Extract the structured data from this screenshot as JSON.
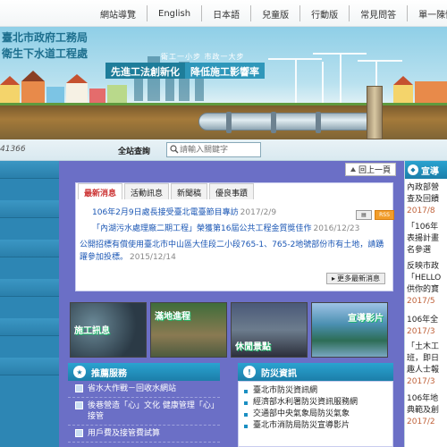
{
  "topnav": {
    "items": [
      "網站導覽",
      "English",
      "日本語",
      "兒童版",
      "行動版",
      "常見問答",
      "單一陳情"
    ]
  },
  "header": {
    "org_line1": "臺北市政府工務局",
    "org_line2": "衛生下水道工程處",
    "slogan_small": "衛工一小步 市政一大步",
    "slogan_a": "先進工法創新化",
    "slogan_b": "降低施工影響率"
  },
  "search": {
    "counter": "41366",
    "label": "全站查詢",
    "placeholder": "請輸入關鍵字"
  },
  "back_top": "回上一頁",
  "news": {
    "tabs": [
      "最新消息",
      "活動訊息",
      "新聞稿",
      "優良事蹟"
    ],
    "items": [
      {
        "title": "106年2月9日處長接受臺北電臺節目專訪",
        "date": "2017/2/9"
      },
      {
        "title": "「內湖污水處理廠二期工程」榮獲第16屆公共工程金質獎佳作",
        "date": "2016/12/23"
      },
      {
        "title": "公開招標有償使用臺北市中山區大佳段二小段765-1、765-2地號部份市有土地，請踴躍參加投標。",
        "date": "2015/12/14"
      }
    ],
    "more": "更多最新消息",
    "icon_rss": "RSS"
  },
  "photos": [
    {
      "caption": "施工訊息"
    },
    {
      "caption": "滿地進程"
    },
    {
      "caption": "休閒景點"
    },
    {
      "caption": "宣導影片"
    }
  ],
  "services": {
    "title": "推薦服務",
    "items": [
      "省水大作戰－回收水網站",
      "後巷營造「心」文化 健康管理「心」接管",
      "用戶費及接管費試算"
    ]
  },
  "disaster": {
    "title": "防災資訊",
    "items": [
      "臺北市防災資訊網",
      "經濟部水利署防災資訊服務網",
      "交通部中央氣象局防災氣象",
      "臺北市消防局防災宣導影片"
    ]
  },
  "right": {
    "title": "宣導",
    "items": [
      {
        "lines": [
          "內政部營",
          "查及回饋"
        ],
        "date": "2017/8"
      },
      {
        "lines": [
          "「106年",
          "表揚計畫",
          "名參選"
        ],
        "date": ""
      },
      {
        "lines": [
          "反映市政",
          "「HELLO",
          "供你的寶"
        ],
        "date": "2017/5"
      },
      {
        "lines": [
          "106年全"
        ],
        "date": "2017/3"
      },
      {
        "lines": [
          "「土木工",
          "班，即日",
          "趣人士報"
        ],
        "date": "2017/3"
      },
      {
        "lines": [
          "106年地",
          "典範及創"
        ],
        "date": "2017/2"
      }
    ]
  },
  "colors": {
    "main_bg": "#6b6fc6",
    "accent": "#1c7ea9",
    "link": "#1a56b4"
  }
}
